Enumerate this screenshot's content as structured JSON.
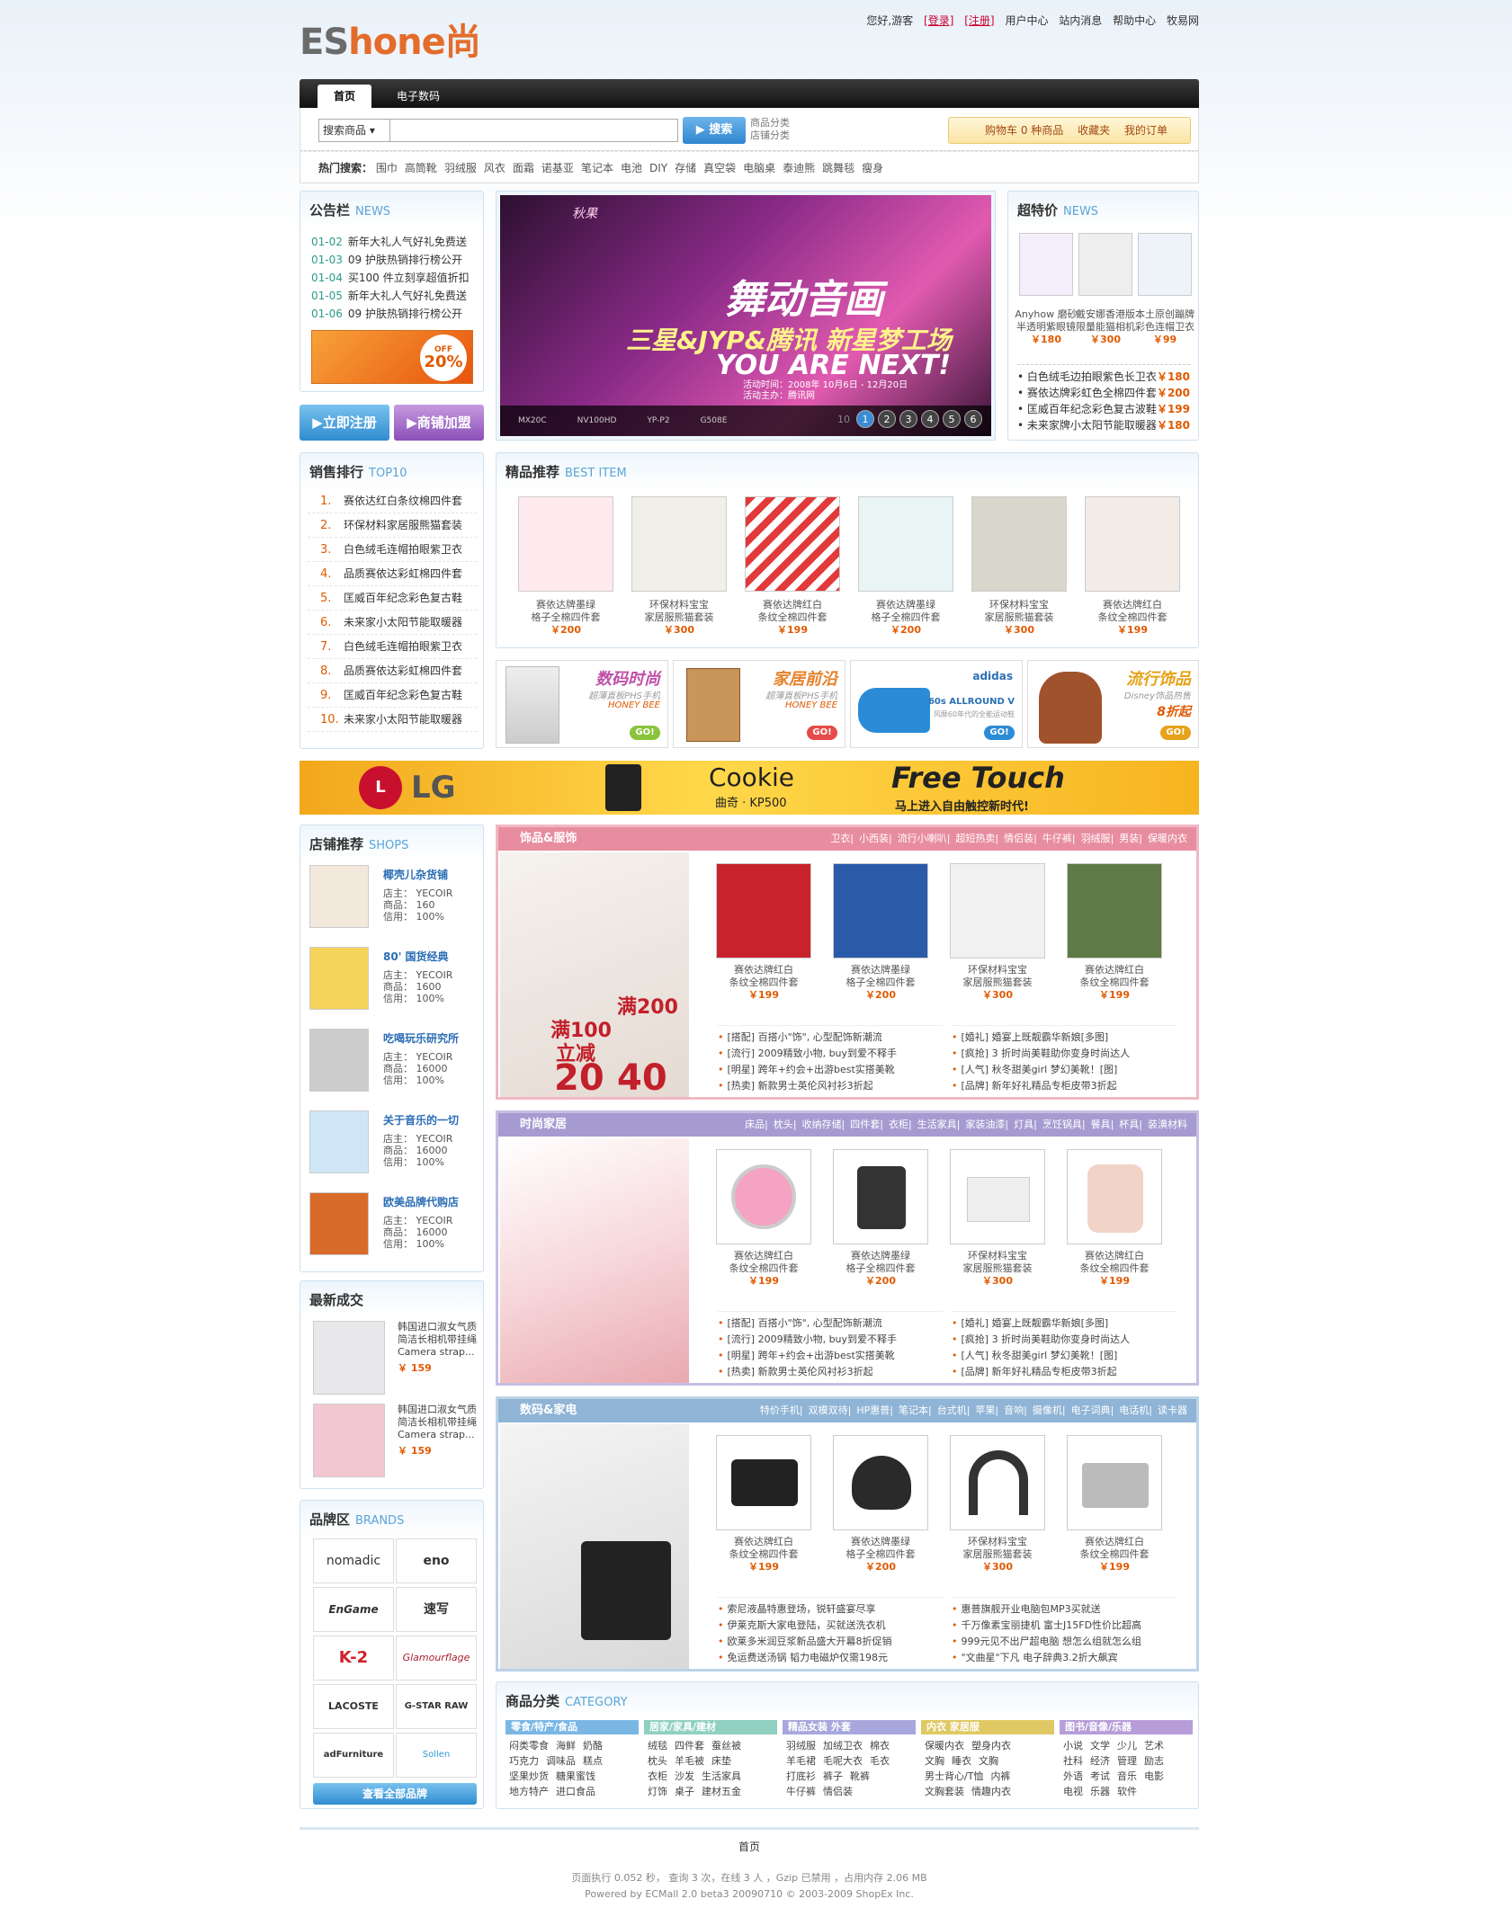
{
  "header": {
    "logo_a": "ES",
    "logo_b": "hone尚",
    "greeting": "您好,游客",
    "login": "[登录]",
    "register": "[注册]",
    "user_center": "用户中心",
    "messages": "站内消息",
    "help": "帮助中心",
    "network": "牧易网"
  },
  "nav": {
    "tabs": [
      "首页",
      "电子数码"
    ]
  },
  "search": {
    "select": "搜索商品",
    "button": "搜索",
    "link1": "商品分类",
    "link2": "店铺分类",
    "cart": "购物车 0 种商品",
    "favorites": "收藏夹",
    "orders": "我的订单"
  },
  "hot": {
    "label": "热门搜索：",
    "terms": [
      "围巾",
      "高筒靴",
      "羽绒服",
      "风衣",
      "面霜",
      "诺基亚",
      "笔记本",
      "电池",
      "DIY",
      "存储",
      "真空袋",
      "电脑桌",
      "泰迪熊",
      "跳舞毯",
      "瘦身"
    ]
  },
  "notice": {
    "title": "公告栏",
    "sub": "NEWS",
    "items": [
      {
        "d": "01-02",
        "t": "新年大礼人气好礼免费送"
      },
      {
        "d": "01-03",
        "t": "09 护肤热销排行榜公开"
      },
      {
        "d": "01-04",
        "t": "买100 件立刻享超值折扣"
      },
      {
        "d": "01-05",
        "t": "新年大礼人气好礼免费送"
      },
      {
        "d": "01-06",
        "t": "09 护肤热销排行榜公开"
      }
    ],
    "promo": "20%",
    "promo_off": "OFF"
  },
  "buttons": {
    "register": "立即注册",
    "join": "商铺加盟"
  },
  "banner": {
    "tag": "秋果",
    "title": "舞动音画",
    "line2": "三星&JYP&腾讯 新星梦工场",
    "line3": "YOU ARE NEXT!",
    "date": "活动时间：2008年 10月6日 - 12月20日",
    "site": "活动主办：腾讯网",
    "models": [
      "MX20C",
      "NV100HD",
      "YP-P2",
      "G508E"
    ],
    "pages": [
      "1",
      "2",
      "3",
      "4",
      "5",
      "6"
    ],
    "page_active": "10"
  },
  "special": {
    "title": "超特价",
    "sub": "NEWS",
    "items": [
      {
        "n": "Anyhow 磨砂半透明紫眼镜",
        "p": "￥180"
      },
      {
        "n": "戴安娜香港版限量能猫相机",
        "p": "￥300"
      },
      {
        "n": "本土原创蹦牌彩色连帽卫衣",
        "p": "￥99"
      }
    ],
    "list": [
      {
        "t": "白色绒毛边拍眼紫色长卫衣",
        "p": "￥180"
      },
      {
        "t": "赛依达牌彩虹色全棉四件套",
        "p": "￥200"
      },
      {
        "t": "匡威百年纪念彩色复古波鞋",
        "p": "￥199"
      },
      {
        "t": "未来家牌小太阳节能取暖器",
        "p": "￥180"
      }
    ]
  },
  "rank": {
    "title": "销售排行",
    "sub": "TOP10",
    "items": [
      "赛依达红白条纹棉四件套",
      "环保材料家居服熊猫套装",
      "白色绒毛连帽拍眼紫卫衣",
      "品质赛依达彩虹棉四件套",
      "匡威百年纪念彩色复古鞋",
      "未来家小太阳节能取暖器",
      "白色绒毛连帽拍眼紫卫衣",
      "品质赛依达彩虹棉四件套",
      "匡威百年纪念彩色复古鞋",
      "未来家小太阳节能取暖器"
    ]
  },
  "best": {
    "title": "精品推荐",
    "sub": "BEST ITEM",
    "items": [
      {
        "n1": "赛依达牌墨绿",
        "n2": "格子全棉四件套",
        "p": "￥200"
      },
      {
        "n1": "环保材料宝宝",
        "n2": "家居服熊猫套装",
        "p": "￥300"
      },
      {
        "n1": "赛依达牌红白",
        "n2": "条纹全棉四件套",
        "p": "￥199"
      },
      {
        "n1": "赛依达牌墨绿",
        "n2": "格子全棉四件套",
        "p": "￥200"
      },
      {
        "n1": "环保材料宝宝",
        "n2": "家居服熊猫套装",
        "p": "￥300"
      },
      {
        "n1": "赛依达牌红白",
        "n2": "条纹全棉四件套",
        "p": "￥199"
      }
    ]
  },
  "promos": [
    {
      "t1": "数码时尚",
      "t2": "超薄直板PHS手机",
      "t3": "HONEY BEE",
      "go": "GO!"
    },
    {
      "t1": "家居前沿",
      "t2": "超薄直板PHS手机",
      "t3": "HONEY BEE",
      "go": "GO!"
    },
    {
      "t1": "60s ALLROUND V",
      "t2": "风靡60年代的全能运动鞋",
      "t3": "adidas",
      "go": "GO!"
    },
    {
      "t1": "流行饰品",
      "t2": "Disney饰品热售",
      "t3": "8折起",
      "go": "GO!"
    }
  ],
  "lg": {
    "brand": "LG",
    "cookie": "Cookie",
    "model": "曲奇 · KP500",
    "free": "Free Touch",
    "slogan": "马上进入自由触控新时代!"
  },
  "shops": {
    "title": "店铺推荐",
    "sub": "SHOPS",
    "items": [
      {
        "n": "椰壳儿杂货铺",
        "o": "店主： YECOIR",
        "g": "商品： 160",
        "c": "信用： 100%"
      },
      {
        "n": "80' 国货经典",
        "o": "店主： YECOIR",
        "g": "商品： 1600",
        "c": "信用： 100%"
      },
      {
        "n": "吃喝玩乐研究所",
        "o": "店主： YECOIR",
        "g": "商品： 16000",
        "c": "信用： 100%"
      },
      {
        "n": "关于音乐的一切",
        "o": "店主： YECOIR",
        "g": "商品： 16000",
        "c": "信用： 100%"
      },
      {
        "n": "欧美品牌代购店",
        "o": "店主： YECOIR",
        "g": "商品： 16000",
        "c": "信用： 100%"
      }
    ]
  },
  "deals": {
    "title": "最新成交",
    "items": [
      {
        "t": "韩国进口淑女气质简洁长相机带挂绳 Camera strap...",
        "p": "￥ 159"
      },
      {
        "t": "韩国进口淑女气质简洁长相机带挂绳 Camera strap...",
        "p": "￥ 159"
      }
    ]
  },
  "brands": {
    "title": "品牌区",
    "sub": "BRANDS",
    "items": [
      "nomadic",
      "eno",
      "EnGame",
      "速写",
      "K-2",
      "Glamourflage",
      "LACOSTE",
      "G-STAR RAW",
      "adFurniture",
      "Sollen"
    ],
    "all": "查看全部品牌"
  },
  "sec1": {
    "title": "饰品&服饰",
    "links": [
      "卫衣",
      "小西装",
      "流行小喇叭",
      "超短热卖",
      "情侣装",
      "牛仔裤",
      "羽绒服",
      "男装",
      "保暖内衣"
    ],
    "promo1": "满100",
    "promo2": "满200",
    "promo3": "立减",
    "promo4": "20",
    "promo5": "40",
    "items": [
      {
        "n1": "赛依达牌红白",
        "n2": "条纹全棉四件套",
        "p": "￥199"
      },
      {
        "n1": "赛依达牌墨绿",
        "n2": "格子全棉四件套",
        "p": "￥200"
      },
      {
        "n1": "环保材料宝宝",
        "n2": "家居服熊猫套装",
        "p": "￥300"
      },
      {
        "n1": "赛依达牌红白",
        "n2": "条纹全棉四件套",
        "p": "￥199"
      }
    ],
    "news_l": [
      "[搭配] 百搭小\"饰\", 心型配饰新潮流",
      "[流行] 2009精致小物, buy到爱不释手",
      "[明星] 跨年+约会+出游best实搭美靴",
      "[热卖] 新款男士英伦风衬衫3折起"
    ],
    "news_r": [
      "[婚礼] 婚宴上既靓霸华新娘[多图]",
      "[疯抢] 3 折时尚美鞋助你变身时尚达人",
      "[人气] 秋冬甜美girl 梦幻美靴！[图]",
      "[品牌] 新年好礼精品专柜皮带3折起"
    ]
  },
  "sec2": {
    "title": "时尚家居",
    "links": [
      "床品",
      "枕头",
      "收纳存储",
      "四件套",
      "衣柜",
      "生活家具",
      "家装油漆",
      "灯具",
      "烹饪锅具",
      "餐具",
      "杯具",
      "装潢材料"
    ],
    "items": [
      {
        "n1": "赛依达牌红白",
        "n2": "条纹全棉四件套",
        "p": "￥199"
      },
      {
        "n1": "赛依达牌墨绿",
        "n2": "格子全棉四件套",
        "p": "￥200"
      },
      {
        "n1": "环保材料宝宝",
        "n2": "家居服熊猫套装",
        "p": "￥300"
      },
      {
        "n1": "赛依达牌红白",
        "n2": "条纹全棉四件套",
        "p": "￥199"
      }
    ],
    "news_l": [
      "[搭配] 百搭小\"饰\", 心型配饰新潮流",
      "[流行] 2009精致小物, buy到爱不释手",
      "[明星] 跨年+约会+出游best实搭美靴",
      "[热卖] 新款男士英伦风衬衫3折起"
    ],
    "news_r": [
      "[婚礼] 婚宴上既靓霸华新娘[多图]",
      "[疯抢] 3 折时尚美鞋助你变身时尚达人",
      "[人气] 秋冬甜美girl 梦幻美靴！[图]",
      "[品牌] 新年好礼精品专柜皮带3折起"
    ]
  },
  "sec3": {
    "title": "数码&家电",
    "links": [
      "特价手机",
      "双模双待",
      "HP惠普",
      "笔记本",
      "台式机",
      "苹果",
      "音响",
      "摄像机",
      "电子词典",
      "电话机",
      "读卡器"
    ],
    "items": [
      {
        "n1": "赛依达牌红白",
        "n2": "条纹全棉四件套",
        "p": "￥199"
      },
      {
        "n1": "赛依达牌墨绿",
        "n2": "格子全棉四件套",
        "p": "￥200"
      },
      {
        "n1": "环保材料宝宝",
        "n2": "家居服熊猫套装",
        "p": "￥300"
      },
      {
        "n1": "赛依达牌红白",
        "n2": "条纹全棉四件套",
        "p": "￥199"
      }
    ],
    "news_l": [
      "索尼液晶特惠登场，锐轩盛宴尽享",
      "伊莱克斯大家电登陆，买就送洗衣机",
      "欧莱多米润豆浆新品盛大开幕8折促销",
      "免运费送汤锅 韬力电磁炉仅需198元"
    ],
    "news_r": [
      "惠普旗舰开业电脑包MP3买就送",
      "千万像素宝丽捷机 富士J15FD性价比超高",
      "999元见不出尸超电脑 想怎么组就怎么组",
      "\"文曲星\"下凡 电子辞典3.2折大飙宾"
    ]
  },
  "category": {
    "title": "商品分类",
    "sub": "CATEGORY",
    "cols": [
      {
        "h": "零食/特产/食品",
        "c": "#7ab7e5",
        "rows": [
          [
            "闷类零食",
            "海鲜",
            "奶酪"
          ],
          [
            "巧克力",
            "调味品",
            "糕点"
          ],
          [
            "坚果炒货",
            "糖果蜜饯"
          ],
          [
            "地方特产",
            "进口食品"
          ]
        ]
      },
      {
        "h": "居家/家具/建材",
        "c": "#8fd0c0",
        "rows": [
          [
            "绒毯",
            "四件套",
            "蚕丝被"
          ],
          [
            "枕头",
            "羊毛被",
            "床垫"
          ],
          [
            "衣柜",
            "沙发",
            "生活家具"
          ],
          [
            "灯饰",
            "桌子",
            "建材五金"
          ]
        ]
      },
      {
        "h": "精品女装 外套",
        "c": "#a7a7dd",
        "rows": [
          [
            "羽绒服",
            "加绒卫衣",
            "棉衣"
          ],
          [
            "羊毛裙",
            "毛呢大衣",
            "毛衣"
          ],
          [
            "打底衫",
            "裤子",
            "靴裤"
          ],
          [
            "牛仔裤",
            "情侣装"
          ]
        ]
      },
      {
        "h": "内衣 家居服",
        "c": "#e0c964",
        "rows": [
          [
            "保暖内衣",
            "塑身内衣"
          ],
          [
            "文胸",
            "睡衣",
            "文胸"
          ],
          [
            "男士背心/T恤",
            "内裤"
          ],
          [
            "文胸套装",
            "情趣内衣"
          ]
        ]
      },
      {
        "h": "图书/音像/乐器",
        "c": "#b79ed8",
        "rows": [
          [
            "小说",
            "文学",
            "少儿",
            "艺术"
          ],
          [
            "社科",
            "经济",
            "管理",
            "励志"
          ],
          [
            "外语",
            "考试",
            "音乐",
            "电影"
          ],
          [
            "电视",
            "乐器",
            "软件"
          ]
        ]
      }
    ]
  },
  "footer": {
    "home": "首页",
    "stats": "页面执行 0.052 秒，  查询 3 次，在线 3 人  ，Gzip 已禁用  ，占用内存 2.06 MB",
    "powered": "Powered by ECMall 2.0 beta3 20090710 © 2003-2009 ShopEx Inc."
  }
}
